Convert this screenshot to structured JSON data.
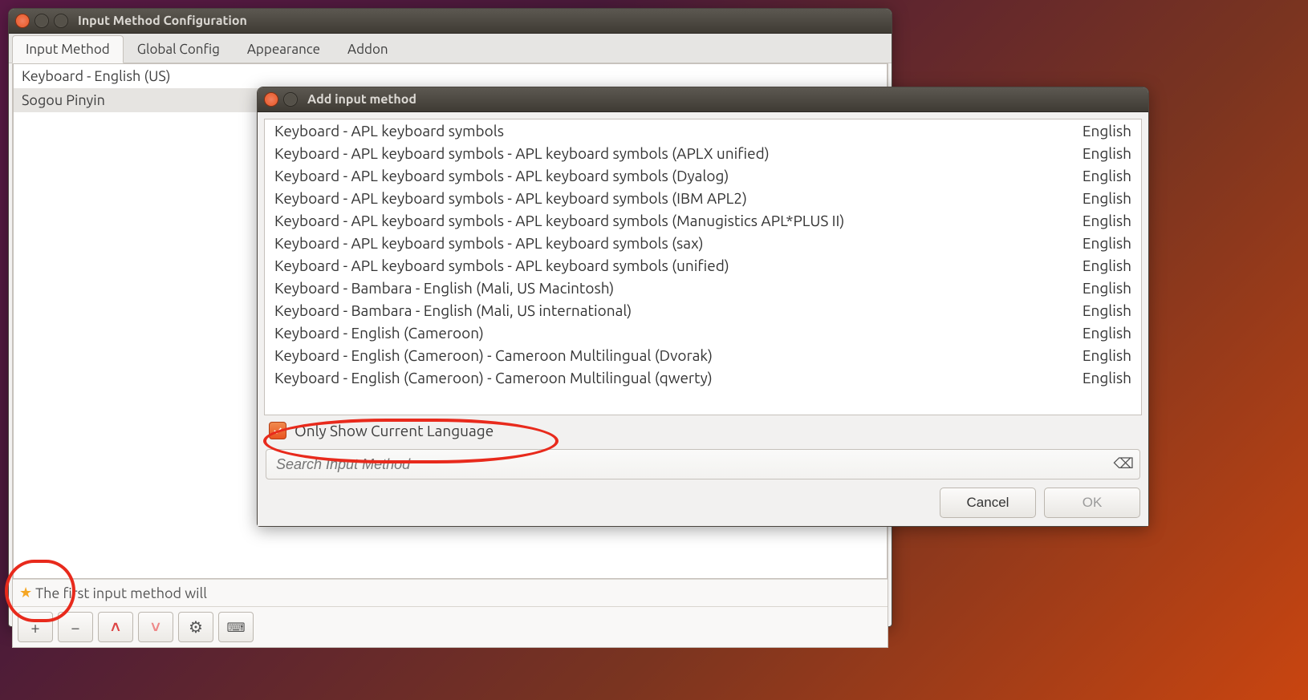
{
  "main_window": {
    "title": "Input Method Configuration",
    "tabs": [
      "Input Method",
      "Global Config",
      "Appearance",
      "Addon"
    ],
    "im_list": [
      "Keyboard - English (US)",
      "Sogou Pinyin"
    ],
    "hint": "The first input method will",
    "toolbar": {
      "add": "+",
      "remove": "−",
      "up": "˄",
      "down": "˅"
    }
  },
  "dialog": {
    "title": "Add input method",
    "methods": [
      {
        "name": "Keyboard - APL keyboard symbols",
        "lang": "English"
      },
      {
        "name": "Keyboard - APL keyboard symbols - APL keyboard symbols (APLX unified)",
        "lang": "English"
      },
      {
        "name": "Keyboard - APL keyboard symbols - APL keyboard symbols (Dyalog)",
        "lang": "English"
      },
      {
        "name": "Keyboard - APL keyboard symbols - APL keyboard symbols (IBM APL2)",
        "lang": "English"
      },
      {
        "name": "Keyboard - APL keyboard symbols - APL keyboard symbols (Manugistics APL*PLUS II)",
        "lang": "English"
      },
      {
        "name": "Keyboard - APL keyboard symbols - APL keyboard symbols (sax)",
        "lang": "English"
      },
      {
        "name": "Keyboard - APL keyboard symbols - APL keyboard symbols (unified)",
        "lang": "English"
      },
      {
        "name": "Keyboard - Bambara - English (Mali, US Macintosh)",
        "lang": "English"
      },
      {
        "name": "Keyboard - Bambara - English (Mali, US international)",
        "lang": "English"
      },
      {
        "name": "Keyboard - English (Cameroon)",
        "lang": "English"
      },
      {
        "name": "Keyboard - English (Cameroon) - Cameroon Multilingual (Dvorak)",
        "lang": "English"
      },
      {
        "name": "Keyboard - English (Cameroon) - Cameroon Multilingual (qwerty)",
        "lang": "English"
      }
    ],
    "only_current_label": "Only Show Current Language",
    "search_placeholder": "Search Input Method",
    "cancel": "Cancel",
    "ok": "OK"
  }
}
